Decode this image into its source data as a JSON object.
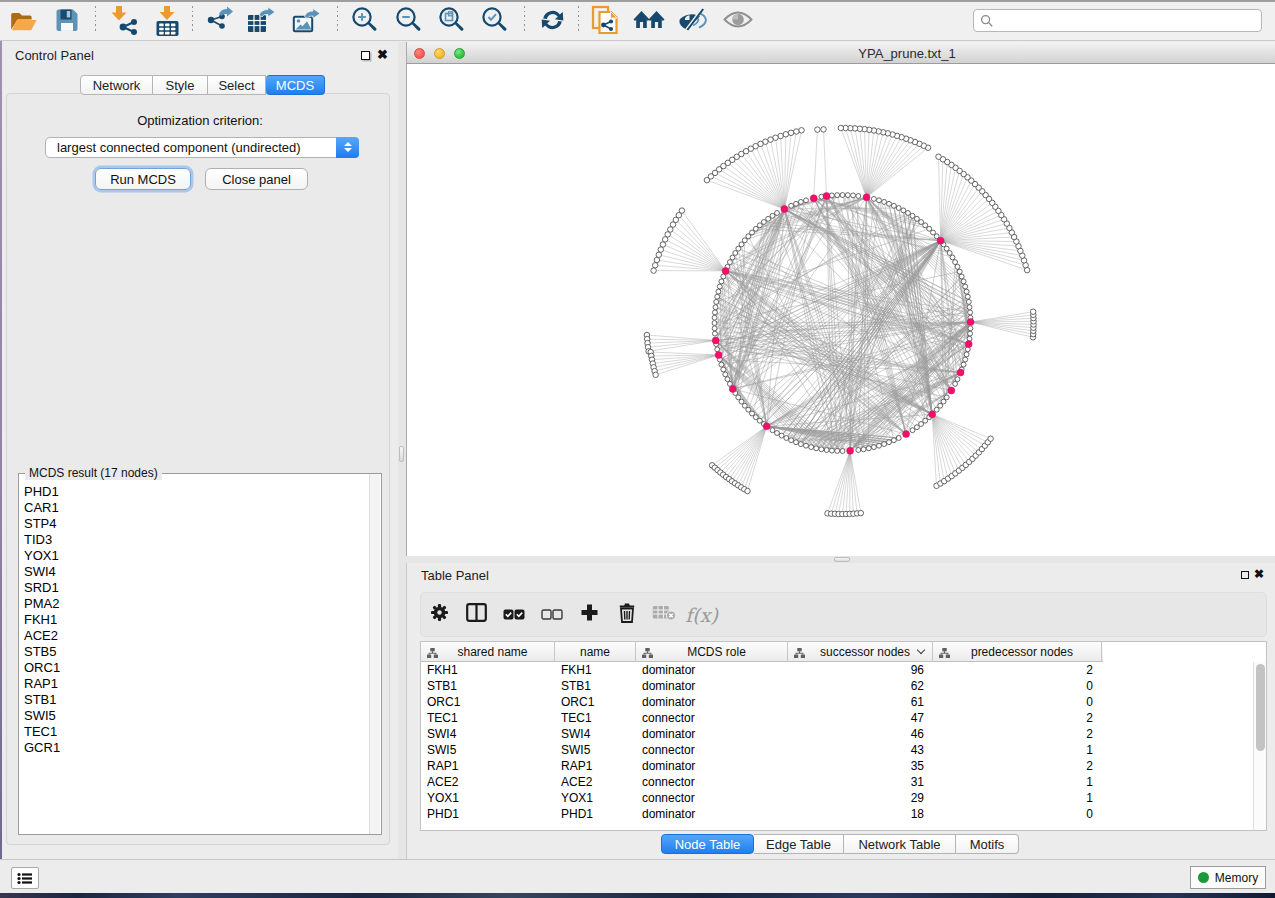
{
  "toolbar": {
    "buttons": [
      {
        "icon": "open-folder-icon"
      },
      {
        "icon": "save-icon"
      },
      {
        "sep": true
      },
      {
        "icon": "import-network-icon"
      },
      {
        "icon": "import-table-icon"
      },
      {
        "sep": true
      },
      {
        "icon": "export-network-icon"
      },
      {
        "icon": "export-table-icon"
      },
      {
        "icon": "export-image-icon"
      },
      {
        "sep": true
      },
      {
        "icon": "zoom-in-icon"
      },
      {
        "icon": "zoom-out-icon"
      },
      {
        "icon": "zoom-fit-icon"
      },
      {
        "icon": "zoom-selected-icon"
      },
      {
        "sep": true
      },
      {
        "icon": "refresh-icon"
      },
      {
        "sep": true
      },
      {
        "icon": "new-network-from-selection-icon"
      },
      {
        "icon": "first-neighbors-icon"
      },
      {
        "icon": "hide-selected-icon"
      },
      {
        "icon": "show-all-icon"
      }
    ],
    "search": {
      "value": "",
      "placeholder": ""
    }
  },
  "control_panel": {
    "title": "Control Panel",
    "tabs": [
      {
        "label": "Network",
        "active": false
      },
      {
        "label": "Style",
        "active": false
      },
      {
        "label": "Select",
        "active": false
      },
      {
        "label": "MCDS",
        "active": true
      }
    ],
    "optimization_label": "Optimization criterion:",
    "criterion_value": "largest connected component (undirected)",
    "run_button": "Run MCDS",
    "close_button": "Close panel",
    "result_group_title": "MCDS result (17 nodes)",
    "result_nodes": [
      "PHD1",
      "CAR1",
      "STP4",
      "TID3",
      "YOX1",
      "SWI4",
      "SRD1",
      "PMA2",
      "FKH1",
      "ACE2",
      "STB5",
      "ORC1",
      "RAP1",
      "STB1",
      "SWI5",
      "TEC1",
      "GCR1"
    ]
  },
  "network_window": {
    "title": "YPA_prune.txt_1"
  },
  "table_panel": {
    "title": "Table Panel",
    "toolbar_icons": [
      "gear-icon",
      "split-pane-icon",
      "select-all-icon",
      "deselect-all-icon",
      "add-icon",
      "delete-icon",
      "delete-table-icon",
      "function-icon"
    ],
    "function_icon_text": "f(x)",
    "columns": [
      {
        "label": "shared name",
        "icon": "tree-icon",
        "width": 134,
        "align": "left"
      },
      {
        "label": "name",
        "icon": null,
        "width": 81,
        "align": "left"
      },
      {
        "label": "MCDS role",
        "icon": "tree-icon",
        "width": 152,
        "align": "left"
      },
      {
        "label": "successor nodes",
        "icon": "tree-icon",
        "sort": "chevron-down-icon",
        "width": 145,
        "align": "right"
      },
      {
        "label": "predecessor nodes",
        "icon": "tree-icon",
        "width": 169,
        "align": "right"
      }
    ],
    "rows": [
      {
        "shared_name": "FKH1",
        "name": "FKH1",
        "role": "dominator",
        "successors": "96",
        "predecessors": "2"
      },
      {
        "shared_name": "STB1",
        "name": "STB1",
        "role": "dominator",
        "successors": "62",
        "predecessors": "0"
      },
      {
        "shared_name": "ORC1",
        "name": "ORC1",
        "role": "dominator",
        "successors": "61",
        "predecessors": "0"
      },
      {
        "shared_name": "TEC1",
        "name": "TEC1",
        "role": "connector",
        "successors": "47",
        "predecessors": "2"
      },
      {
        "shared_name": "SWI4",
        "name": "SWI4",
        "role": "dominator",
        "successors": "46",
        "predecessors": "2"
      },
      {
        "shared_name": "SWI5",
        "name": "SWI5",
        "role": "connector",
        "successors": "43",
        "predecessors": "1"
      },
      {
        "shared_name": "RAP1",
        "name": "RAP1",
        "role": "dominator",
        "successors": "35",
        "predecessors": "2"
      },
      {
        "shared_name": "ACE2",
        "name": "ACE2",
        "role": "connector",
        "successors": "31",
        "predecessors": "1"
      },
      {
        "shared_name": "YOX1",
        "name": "YOX1",
        "role": "connector",
        "successors": "29",
        "predecessors": "1"
      },
      {
        "shared_name": "PHD1",
        "name": "PHD1",
        "role": "dominator",
        "successors": "18",
        "predecessors": "0"
      }
    ],
    "tabs": [
      {
        "label": "Node Table",
        "active": true
      },
      {
        "label": "Edge Table",
        "active": false
      },
      {
        "label": "Network Table",
        "active": false
      },
      {
        "label": "Motifs",
        "active": false
      }
    ]
  },
  "status_bar": {
    "memory_label": "Memory"
  },
  "chart_data": {
    "type": "network-circular-layout",
    "description": "Gene regulatory network YPA_prune.txt_1 in circular layout; pink nodes are the 17 MCDS dominator/connector genes, white nodes are regular genes; fans of leaf nodes outside the main circle are attached to hub genes",
    "center": [
      434.5,
      259
    ],
    "ring_radius": 128,
    "ring_node_count": 152,
    "node_color": "#ffffff",
    "node_stroke": "#4d4d4d",
    "hub_color": "#f2106c",
    "edge_color": "#a2a2a2",
    "pink_node_angles_deg": [
      117,
      103,
      97.2,
      79.2,
      40,
      156,
      0.4,
      187.8,
      194.5,
      233.7,
      273.4,
      314.5,
      350.5,
      337.2,
      328.2,
      299.8,
      211
    ],
    "fans": [
      {
        "apex": 117,
        "from": 102,
        "to": 133.5,
        "radius": 197,
        "count": 21
      },
      {
        "apex": 103,
        "from": 97.4,
        "to": 97.4,
        "radius": 195,
        "count": 1
      },
      {
        "apex": 97.2,
        "from": 95.6,
        "to": 95.6,
        "radius": 194.5,
        "count": 1
      },
      {
        "apex": 79.2,
        "from": 64,
        "to": 90.5,
        "radius": 195,
        "count": 20
      },
      {
        "apex": 40,
        "from": 16,
        "to": 60,
        "radius": 192,
        "count": 30
      },
      {
        "apex": 0.4,
        "from": -4.3,
        "to": 3.4,
        "radius": 191,
        "count": 9
      },
      {
        "apex": 156,
        "from": 145,
        "to": 164.5,
        "radius": 196,
        "count": 13
      },
      {
        "apex": 187.8,
        "from": 183.5,
        "to": 188.3,
        "radius": 196,
        "count": 5
      },
      {
        "apex": 194.5,
        "from": 188.6,
        "to": 195.5,
        "radius": 194,
        "count": 7
      },
      {
        "apex": 233.7,
        "from": 227.5,
        "to": 240.5,
        "radius": 193,
        "count": 13
      },
      {
        "apex": 273.4,
        "from": 265.5,
        "to": 275.5,
        "radius": 191,
        "count": 10
      },
      {
        "apex": 314.5,
        "from": 300,
        "to": 322,
        "radius": 188,
        "count": 17
      }
    ],
    "hub_interior_degrees": [
      38,
      12,
      12,
      28,
      48,
      14,
      22,
      12,
      12,
      30,
      18,
      26,
      14,
      12,
      12,
      12,
      16
    ],
    "random_chords": 58,
    "seed": 7
  }
}
